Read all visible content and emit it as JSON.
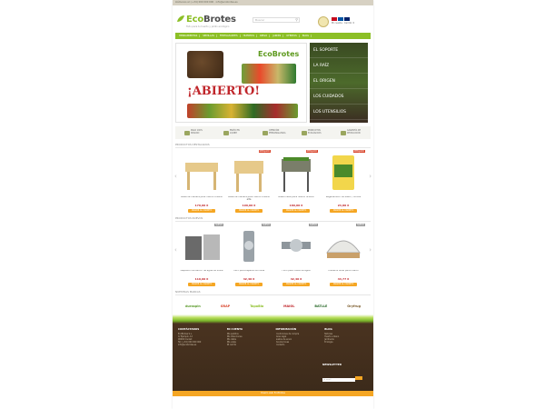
{
  "topbar": {
    "text": "Llámenos al: (+34) 000 000 000   ·   info@ecobrotes.es"
  },
  "header": {
    "logo_prefix": "Eco",
    "logo_suffix": "Brotes",
    "tagline": "Todo para tu huerto y jardín ecológico",
    "search_placeholder": "Buscar",
    "account_text": "Mi cuenta · Carrito: 0"
  },
  "nav": {
    "items": [
      "HERRAMIENTAS",
      "SEMILLAS",
      "FERTILIZANTES",
      "HUERTOS",
      "RIEGO",
      "JARDÍN",
      "OFERTAS",
      "BLOG"
    ]
  },
  "hero": {
    "logo": "EcoBrotes",
    "headline": "¡ABIERTO!",
    "side_items": [
      "EL SOPORTE",
      "LA RAÍZ",
      "EL ORIGEN",
      "LOS CUIDADOS",
      "LOS UTENSILIOS"
    ]
  },
  "features": [
    "PAGO 100% SEGURO",
    "ENVÍO EN 24/48H",
    "ATENCIÓN PERSONALIZADA",
    "PRODUCTOS ECOLÓGICOS",
    "GARANTÍA DE DEVOLUCIÓN"
  ],
  "sections": {
    "featured": "PRODUCTOS DESTACADOS",
    "new": "PRODUCTOS NUEVOS",
    "brands": "NUESTRAS MARCAS"
  },
  "featured_products": [
    {
      "name": "Mesa de madera para huerto urbano",
      "price": "179,00 €",
      "ribbon": "",
      "btn": "AÑADIR AL CARRITO"
    },
    {
      "name": "Mesa de madera para huerto urbano alta",
      "price": "199,00 €",
      "ribbon": "REBAJADO",
      "btn": "AÑADIR AL CARRITO"
    },
    {
      "name": "Mesa metal para huerto urbano",
      "price": "189,00 €",
      "ribbon": "REBAJADO",
      "btn": "AÑADIR AL CARRITO"
    },
    {
      "name": "Regenerador de suelo / humus",
      "price": "24,80 €",
      "ribbon": "REBAJADO",
      "btn": "AÑADIR AL CARRITO"
    }
  ],
  "new_products": [
    {
      "name": "Depósito recolector de agua de lluvia",
      "price": "119,00 €",
      "ribbon": "NUEVO",
      "btn": "AÑADIR AL CARRITO"
    },
    {
      "name": "Filtro para bajante de lluvia",
      "price": "42,40 €",
      "ribbon": "NUEVO",
      "btn": "AÑADIR AL CARRITO"
    },
    {
      "name": "Filtro para caída de agua",
      "price": "42,40 €",
      "ribbon": "NUEVO",
      "btn": "AÑADIR AL CARRITO"
    },
    {
      "name": "Cubierta túnel para huerto",
      "price": "44,77 €",
      "ribbon": "NUEVO",
      "btn": "AÑADIR AL CARRITO"
    }
  ],
  "brands": [
    "duraspin",
    "GRAP",
    "TopoBio",
    "MAIOL",
    "BATLLE",
    "Oryfrug"
  ],
  "footer": {
    "col1_title": "CONTÁCTANOS",
    "col1_lines": [
      "EcoBrotes S.L.",
      "C/ Ejemplo, 12",
      "00000 Ciudad",
      "Tel: (+34) 000 000 000",
      "info@ecobrotes.es"
    ],
    "col2_title": "MI CUENTA",
    "col2_lines": [
      "Mis pedidos",
      "Mis direcciones",
      "Mis datos",
      "Mis vales",
      "Mi carrito"
    ],
    "col3_title": "INFORMACIÓN",
    "col3_lines": [
      "Condiciones de compra",
      "Aviso legal",
      "Gastos de envío",
      "Devoluciones",
      "Contacto"
    ],
    "col4_title": "BLOG",
    "col4_lines": [
      "Noticias",
      "Huerto urbano",
      "Jardinería",
      "Ecología"
    ],
    "newsletter_title": "NEWSLETTER",
    "newsletter_placeholder": "Tu email",
    "bottom_text": "Diseño web EcoBrotes"
  },
  "colors": {
    "brand_green": "#8cbf26",
    "accent_orange": "#f5a623",
    "price_red": "#c0262b",
    "footer_brown": "#4a3320"
  }
}
